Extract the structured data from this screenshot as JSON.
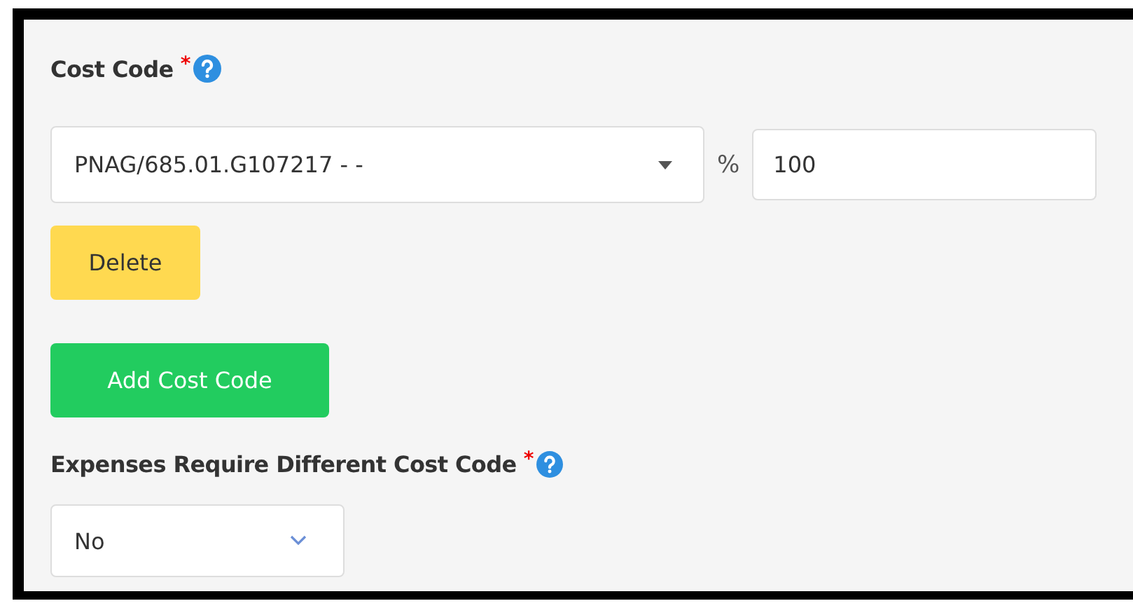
{
  "cost_code": {
    "label": "Cost Code",
    "required_mark": "*",
    "help": true,
    "select_value": "PNAG/685.01.G107217 - -",
    "percent_sign": "%",
    "percent_value": "100"
  },
  "delete_button": "Delete",
  "add_button": "Add Cost Code",
  "expenses": {
    "label": "Expenses Require Different Cost Code",
    "required_mark": "*",
    "help": true,
    "select_value": "No"
  }
}
